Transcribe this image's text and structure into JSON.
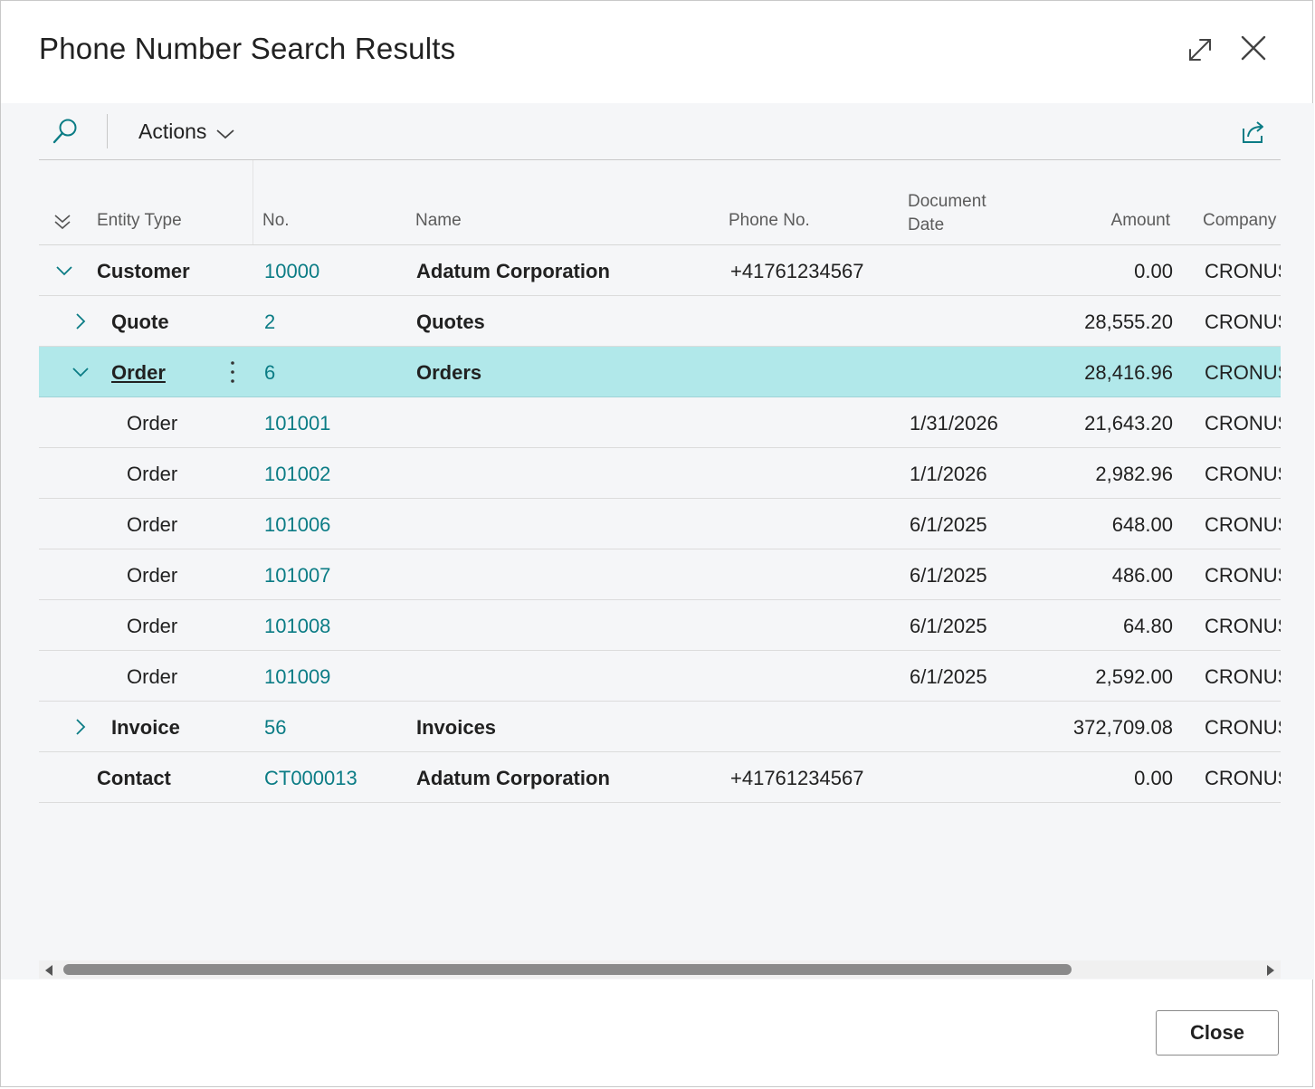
{
  "dialog": {
    "title": "Phone Number Search Results",
    "close_label": "Close"
  },
  "toolbar": {
    "actions_label": "Actions"
  },
  "columns": {
    "entity_type": "Entity Type",
    "no": "No.",
    "name": "Name",
    "phone_no": "Phone No.",
    "document_date_line1": "Document",
    "document_date_line2": "Date",
    "amount": "Amount",
    "company": "Company"
  },
  "rows": [
    {
      "entity_type": "Customer",
      "no": "10000",
      "name": "Adatum Corporation",
      "phone": "+41761234567",
      "date": "",
      "amount": "0.00",
      "company": "CRONUS",
      "level": 0,
      "expanded": true,
      "bold": true
    },
    {
      "entity_type": "Quote",
      "no": "2",
      "name": "Quotes",
      "phone": "",
      "date": "",
      "amount": "28,555.20",
      "company": "CRONUS",
      "level": 1,
      "expanded": false,
      "bold": true
    },
    {
      "entity_type": "Order",
      "no": "6",
      "name": "Orders",
      "phone": "",
      "date": "",
      "amount": "28,416.96",
      "company": "CRONUS",
      "level": 1,
      "expanded": true,
      "bold": true,
      "selected": true
    },
    {
      "entity_type": "Order",
      "no": "101001",
      "name": "",
      "phone": "",
      "date": "1/31/2026",
      "amount": "21,643.20",
      "company": "CRONUS",
      "level": 2
    },
    {
      "entity_type": "Order",
      "no": "101002",
      "name": "",
      "phone": "",
      "date": "1/1/2026",
      "amount": "2,982.96",
      "company": "CRONUS",
      "level": 2
    },
    {
      "entity_type": "Order",
      "no": "101006",
      "name": "",
      "phone": "",
      "date": "6/1/2025",
      "amount": "648.00",
      "company": "CRONUS",
      "level": 2
    },
    {
      "entity_type": "Order",
      "no": "101007",
      "name": "",
      "phone": "",
      "date": "6/1/2025",
      "amount": "486.00",
      "company": "CRONUS",
      "level": 2
    },
    {
      "entity_type": "Order",
      "no": "101008",
      "name": "",
      "phone": "",
      "date": "6/1/2025",
      "amount": "64.80",
      "company": "CRONUS",
      "level": 2
    },
    {
      "entity_type": "Order",
      "no": "101009",
      "name": "",
      "phone": "",
      "date": "6/1/2025",
      "amount": "2,592.00",
      "company": "CRONUS",
      "level": 2
    },
    {
      "entity_type": "Invoice",
      "no": "56",
      "name": "Invoices",
      "phone": "",
      "date": "",
      "amount": "372,709.08",
      "company": "CRONUS",
      "level": 1,
      "expanded": false,
      "bold": true
    },
    {
      "entity_type": "Contact",
      "no": "CT000013",
      "name": "Adatum Corporation",
      "phone": "+41761234567",
      "date": "",
      "amount": "0.00",
      "company": "CRONUS",
      "level": 0,
      "bold": true
    }
  ],
  "icons": {
    "expand": "expand-diagonal-icon",
    "close": "close-icon",
    "search": "search-icon",
    "actions_chevron": "chevron-down-icon",
    "share": "share-icon",
    "collapse_all": "collapse-all-icon",
    "row_expanded": "chevron-down-icon",
    "row_collapsed": "chevron-right-icon",
    "context_menu": "more-vertical-icon"
  },
  "colors": {
    "link": "#0b7c85",
    "selected_row": "#b1e8ea",
    "content_bg": "#f5f6f8"
  }
}
